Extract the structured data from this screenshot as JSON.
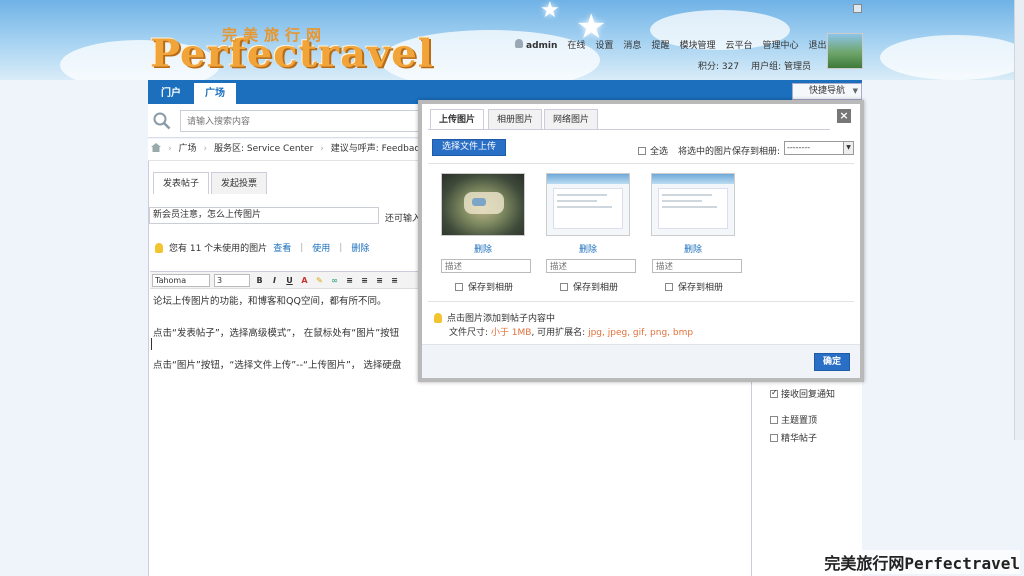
{
  "logo": {
    "cn": "完美旅行网",
    "en": "Perfectravel"
  },
  "user": {
    "name": "admin",
    "status": "在线",
    "links": [
      "设置",
      "消息",
      "提醒",
      "模块管理",
      "云平台",
      "管理中心",
      "退出"
    ],
    "points": "积分: 327",
    "group": "用户组: 管理员"
  },
  "nav": {
    "tabs": [
      "门户",
      "广场"
    ],
    "active": 1,
    "quicknav": "快捷导航"
  },
  "search": {
    "placeholder": "请输入搜索内容"
  },
  "breadcrumb": [
    "广场",
    "服务区: Service Center",
    "建议与呼声: Feedback"
  ],
  "post": {
    "tabs": [
      "发表帖子",
      "发起投票"
    ],
    "subject": "新会员注意，怎么上传图片",
    "can_input": "还可输入",
    "tip": "您有 11 个未使用的图片",
    "tip_links": [
      "查看",
      "使用",
      "删除"
    ],
    "font": "Tahoma",
    "size": "3",
    "body": [
      "论坛上传图片的功能，和博客和QQ空间，都有所不同。",
      "点击“发表帖子”，选择高级模式”，  在鼠标处有“图片”按钮",
      "点击“图片”按钮，“选择文件上传”--“上传图片”，  选择硬盘"
    ]
  },
  "options": [
    "接收回复通知",
    "主题置顶",
    "精华帖子"
  ],
  "options_checked": [
    true,
    false,
    false
  ],
  "dialog": {
    "tabs": [
      "上传图片",
      "相册图片",
      "网络图片"
    ],
    "upload_button": "选择文件上传",
    "select_all": "全选",
    "save_to": "将选中的图片保存到相册:",
    "album_value": "--------",
    "items": [
      {
        "delete": "删除",
        "desc_placeholder": "描述",
        "save": "保存到相册"
      },
      {
        "delete": "删除",
        "desc_placeholder": "描述",
        "save": "保存到相册"
      },
      {
        "delete": "删除",
        "desc_placeholder": "描述",
        "save": "保存到相册"
      }
    ],
    "hint": "点击图片添加到帖子内容中",
    "size_label": "文件尺寸:",
    "size_value": "小于 1MB",
    "ext_label": ", 可用扩展名:",
    "ext_value": "jpg, jpeg, gif, png, bmp",
    "ok": "确定"
  },
  "watermark": "完美旅行网Perfectravel",
  "colors": {
    "nav": "#1b6fbd",
    "button": "#2a6fc6",
    "logo": "#f1a43a",
    "hint_orange": "#e2703a"
  }
}
